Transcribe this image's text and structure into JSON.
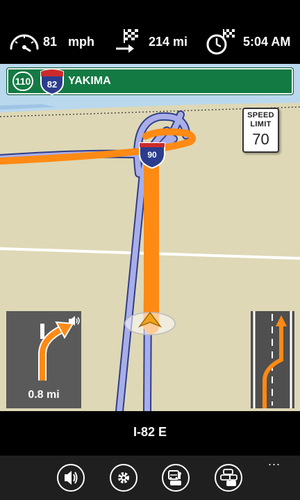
{
  "status": {
    "speed_value": "81",
    "speed_unit": "mph",
    "distance_remaining": "214 mi",
    "arrival_time": "5:04 AM",
    "icons": [
      "speedometer-icon",
      "finish-distance-icon",
      "finish-time-icon"
    ]
  },
  "guidance_sign": {
    "exit_number": "110",
    "interstate_shield": "82",
    "destination": "YAKIMA",
    "sign_color": "#147a44"
  },
  "map": {
    "route_shield": "90",
    "route_color": "#ff8a14",
    "road_color": "#a9aee8",
    "land_color": "#ded8b6",
    "water_color": "#a6cbeb"
  },
  "speed_limit": {
    "label_line1": "SPEED",
    "label_line2": "LIMIT",
    "value": "70"
  },
  "turn": {
    "distance": "0.8 mi",
    "icons": [
      "keep-right-arrow-icon",
      "speaker-icon"
    ]
  },
  "lane_guidance": {
    "icons": [
      "lane-change-right-icon"
    ]
  },
  "road": {
    "current": "I-82 E"
  },
  "appbar": {
    "buttons": [
      "volume-icon",
      "settings-icon",
      "traffic-camera-icon",
      "traffic-icon"
    ],
    "more": "..."
  }
}
